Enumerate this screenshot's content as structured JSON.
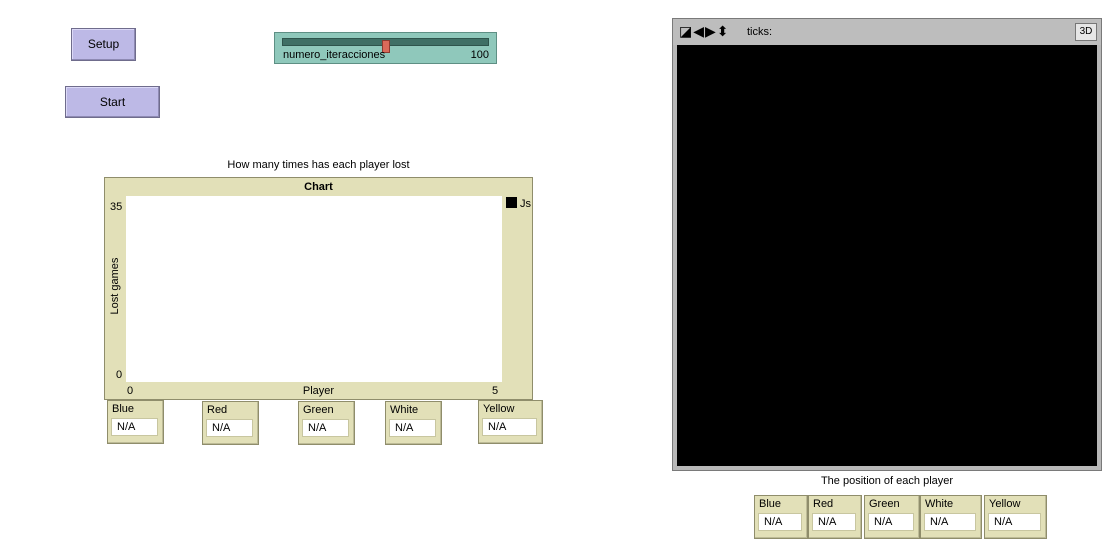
{
  "buttons": {
    "setup_label": "Setup",
    "start_label": "Start"
  },
  "slider": {
    "label": "numero_iteracciones",
    "value": "100",
    "position_fraction": 0.5
  },
  "plot": {
    "caption": "How many times has each player lost",
    "name": "Chart",
    "legend_label": "Js",
    "legend_color": "#000000"
  },
  "chart_data": {
    "type": "line",
    "title": "Chart",
    "xlabel": "Player",
    "ylabel": "Lost games",
    "xlim": [
      0,
      5
    ],
    "ylim": [
      0,
      35
    ],
    "x_tick_labels": [
      "0",
      "5"
    ],
    "y_tick_labels": [
      "0",
      "35"
    ],
    "legend_position": "top-right",
    "series": [
      {
        "name": "Js",
        "color": "#000000",
        "values": []
      }
    ]
  },
  "lost_monitors": [
    {
      "label": "Blue",
      "value": "N/A"
    },
    {
      "label": "Red",
      "value": "N/A"
    },
    {
      "label": "Green",
      "value": "N/A"
    },
    {
      "label": "White",
      "value": "N/A"
    },
    {
      "label": "Yellow",
      "value": "N/A"
    }
  ],
  "view": {
    "ticks_label": "ticks:",
    "three_d_label": "3D",
    "caption": "The position of each player",
    "background_color": "#000000"
  },
  "position_monitors": [
    {
      "label": "Blue",
      "value": "N/A"
    },
    {
      "label": "Red",
      "value": "N/A"
    },
    {
      "label": "Green",
      "value": "N/A"
    },
    {
      "label": "White",
      "value": "N/A"
    },
    {
      "label": "Yellow",
      "value": "N/A"
    }
  ]
}
